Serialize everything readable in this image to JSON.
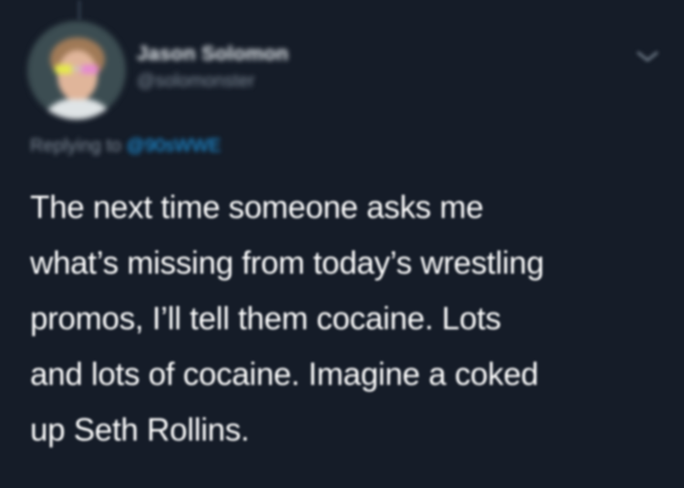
{
  "author": {
    "display_name": "Jason Solomon",
    "handle": "@solomonster"
  },
  "reply": {
    "prefix": "Replying to",
    "mention": "@90sWWE"
  },
  "tweet": {
    "text": "The next time someone asks me\nwhat’s missing from today’s wrestling\npromos, I’ll tell them cocaine.  Lots\nand lots of cocaine.  Imagine a coked\nup Seth Rollins."
  },
  "icons": {
    "menu": "chevron-down-icon",
    "avatar": "profile-photo"
  },
  "colors": {
    "background": "#151c28",
    "text": "#ffffff",
    "secondary": "#7f8b98",
    "link": "#1da1f2"
  }
}
